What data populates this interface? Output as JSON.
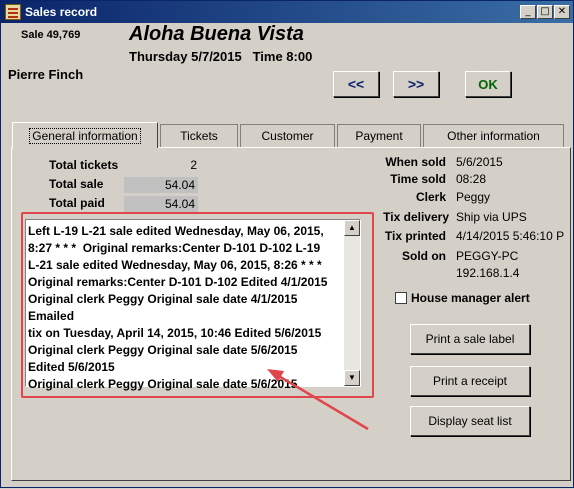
{
  "window": {
    "title": "Sales record",
    "controls": {
      "minimize": "_",
      "maximize": "□",
      "close": "✕"
    }
  },
  "header": {
    "sale_number": "Sale 49,769",
    "company": "Aloha Buena Vista",
    "datetime": "Thursday 5/7/2015   Time 8:00",
    "customer": "Pierre Finch",
    "prev_label": "<<",
    "next_label": ">>",
    "ok_label": "OK"
  },
  "tabs": [
    {
      "label": "General information",
      "active": true
    },
    {
      "label": "Tickets",
      "active": false
    },
    {
      "label": "Customer",
      "active": false
    },
    {
      "label": "Payment",
      "active": false
    },
    {
      "label": "Other information",
      "active": false
    }
  ],
  "totals": {
    "tickets_label": "Total tickets",
    "tickets_value": "2",
    "sale_label": "Total sale",
    "sale_value": "54.04",
    "paid_label": "Total paid",
    "paid_value": "54.04"
  },
  "details": [
    {
      "label": "When sold",
      "value": "5/6/2015"
    },
    {
      "label": "Time sold",
      "value": "08:28"
    },
    {
      "label": "Clerk",
      "value": "Peggy"
    },
    {
      "label": "Tix delivery",
      "value": "Ship via UPS"
    },
    {
      "label": "Tix printed",
      "value": "4/14/2015 5:46:10 P"
    },
    {
      "label": "Sold on",
      "value": "PEGGY-PC"
    },
    {
      "label": "",
      "value": "192.168.1.4"
    }
  ],
  "notes": "Left L-19 L-21 sale edited Wednesday, May 06, 2015,\n8:27 * * *  Original remarks:Center D-101 D-102 L-19\nL-21 sale edited Wednesday, May 06, 2015, 8:26 * * *\nOriginal remarks:Center D-101 D-102 Edited 4/1/2015\nOriginal clerk Peggy Original sale date 4/1/2015 Emailed\ntix on Tuesday, April 14, 2015, 10:46 Edited 5/6/2015\nOriginal clerk Peggy Original sale date 5/6/2015\nEdited 5/6/2015\nOriginal clerk Peggy Original sale date 5/6/2015",
  "house_manager_alert": {
    "label": "House manager alert",
    "checked": false
  },
  "actions": {
    "print_label": "Print a sale label",
    "print_receipt": "Print a receipt",
    "display_seats": "Display seat list"
  },
  "colors": {
    "annotation": "#e0474c",
    "titlebar": "#0a246a",
    "ok_text": "#006400"
  }
}
